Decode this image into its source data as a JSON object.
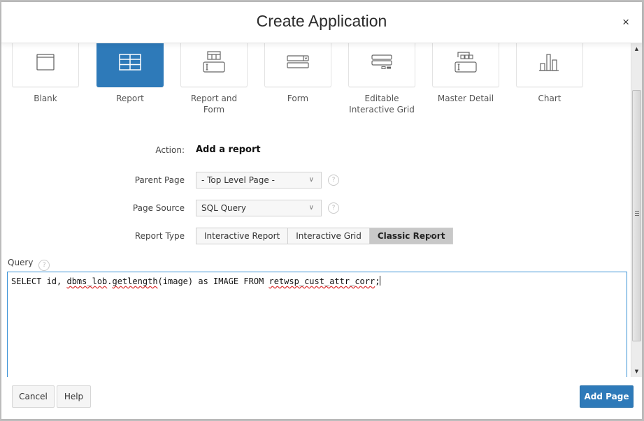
{
  "dialog": {
    "title": "Create Application",
    "close_label": "×"
  },
  "page_types": [
    {
      "label": "Blank",
      "icon": "blank-page-icon",
      "selected": false
    },
    {
      "label": "Report",
      "icon": "report-grid-icon",
      "selected": true
    },
    {
      "label": "Report and Form",
      "icon": "report-and-form-icon",
      "selected": false
    },
    {
      "label": "Form",
      "icon": "form-icon",
      "selected": false
    },
    {
      "label": "Editable Interactive Grid",
      "icon": "editable-grid-icon",
      "selected": false
    },
    {
      "label": "Master Detail",
      "icon": "master-detail-icon",
      "selected": false
    },
    {
      "label": "Chart",
      "icon": "bar-chart-icon",
      "selected": false
    }
  ],
  "form": {
    "action_label": "Action:",
    "action_value": "Add a report",
    "parent_page_label": "Parent Page",
    "parent_page_value": "- Top Level Page -",
    "page_source_label": "Page Source",
    "page_source_value": "SQL Query",
    "report_type_label": "Report Type",
    "report_types": [
      "Interactive Report",
      "Interactive Grid",
      "Classic Report"
    ],
    "report_type_selected": "Classic Report",
    "help_glyph": "?"
  },
  "query": {
    "label": "Query",
    "parts": [
      "SELECT id, ",
      "dbms_lob",
      ".",
      "getlength",
      "(image) as IMAGE FROM ",
      "retwsp_cust_attr_corr",
      ";"
    ]
  },
  "footer": {
    "cancel_label": "Cancel",
    "help_label": "Help",
    "add_page_label": "Add Page"
  },
  "colors": {
    "accent": "#2e7ab9"
  }
}
